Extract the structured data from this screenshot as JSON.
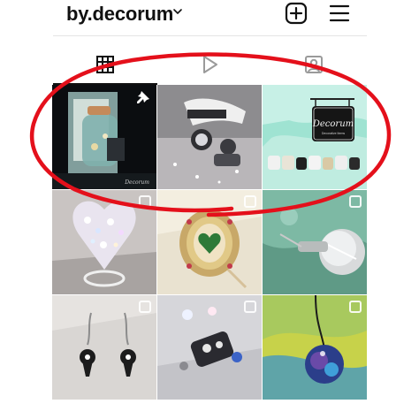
{
  "header": {
    "profile_name": "by.decorum",
    "icons": [
      "chevron-down-icon",
      "new-post-icon",
      "menu-icon"
    ]
  },
  "tabs": [
    {
      "id": "posts",
      "icon": "grid-icon",
      "active": true
    },
    {
      "id": "reels",
      "icon": "play-icon",
      "active": false
    },
    {
      "id": "tagged",
      "icon": "tagged-person-icon",
      "active": false
    }
  ],
  "sign_text": {
    "brand": "Decorum",
    "tagline": "Decorative Items"
  },
  "grid_posts": [
    {
      "row": 1,
      "col": 1,
      "subject": "potion bottle charm",
      "pinned": true
    },
    {
      "row": 1,
      "col": 2,
      "subject": "rhinestone hand jewelry",
      "multi": false
    },
    {
      "row": 1,
      "col": 3,
      "subject": "Decorum signboard with keychains",
      "multi": false
    },
    {
      "row": 2,
      "col": 1,
      "subject": "crystal heart ring",
      "multi": true
    },
    {
      "row": 2,
      "col": 2,
      "subject": "gold frame green heart",
      "multi": true
    },
    {
      "row": 2,
      "col": 3,
      "subject": "crystal ball pendant",
      "multi": true
    },
    {
      "row": 3,
      "col": 1,
      "subject": "keyhole earrings",
      "multi": false
    },
    {
      "row": 3,
      "col": 2,
      "subject": "skull charm bracelet",
      "multi": true
    },
    {
      "row": 3,
      "col": 3,
      "subject": "galaxy dome necklace",
      "multi": true
    }
  ],
  "colors": {
    "annotation": "#e4101b",
    "divider": "#e5e5e5",
    "text": "#111111"
  }
}
